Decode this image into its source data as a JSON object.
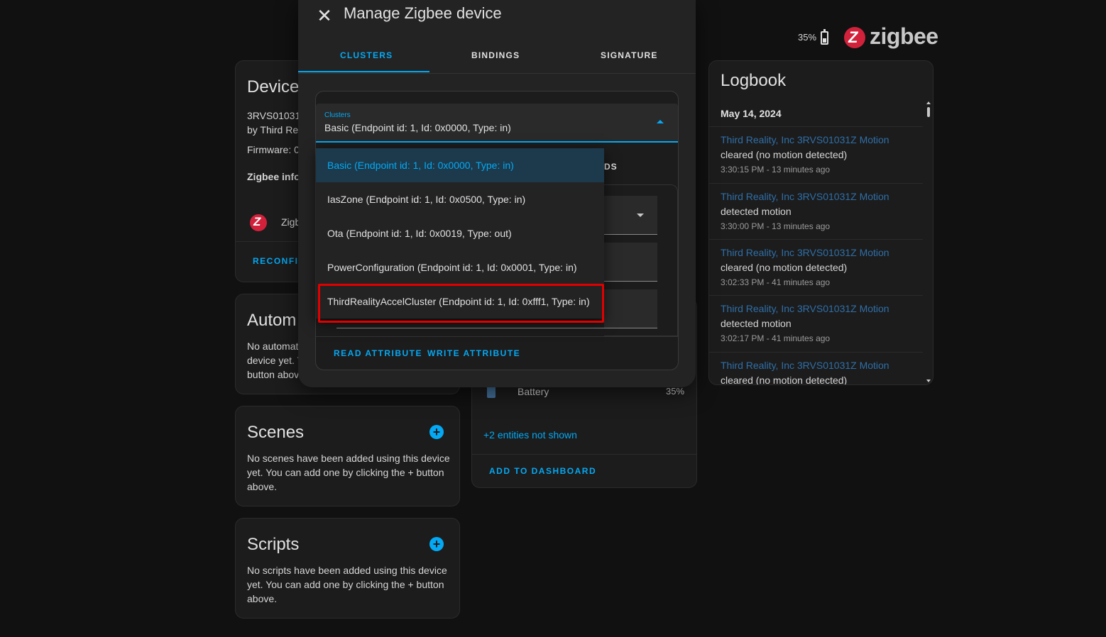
{
  "header": {
    "battery_percent": "35%",
    "brand_word": "zigbee",
    "brand_color": "#d1213b"
  },
  "device_card": {
    "title": "Device",
    "model": "3RVS01031",
    "manufacturer": "by Third Rea",
    "firmware": "Firmware: 0",
    "zigbee_info": "Zigbee info",
    "zigbee_row_label": "Zigb",
    "reconfigure": "RECONFIG"
  },
  "automations_card": {
    "title": "Autom",
    "text_lines": [
      "No automat",
      "device yet. Y",
      "button abov"
    ]
  },
  "scenes_card": {
    "title": "Scenes",
    "plus": "+",
    "text_lines": [
      "No scenes have been added using this device",
      "yet. You can add one by clicking the + button",
      "above."
    ]
  },
  "scripts_card": {
    "title": "Scripts",
    "plus": "+",
    "text_lines": [
      "No scripts have been added using this device",
      "yet. You can add one by clicking the + button",
      "above."
    ]
  },
  "entities_card": {
    "battery_label": "Battery",
    "battery_value": "35%",
    "not_shown": "+2 entities not shown",
    "add_to_dashboard": "ADD TO DASHBOARD"
  },
  "dialog": {
    "close_icon": "close-icon",
    "title": "Manage Zigbee device",
    "tabs": [
      "CLUSTERS",
      "BINDINGS",
      "SIGNATURE"
    ],
    "active_tab": "CLUSTERS",
    "select": {
      "label": "Clusters",
      "value": "Basic (Endpoint id: 1, Id: 0x0000, Type: in)"
    },
    "obscured_tail": "DS",
    "options": [
      "Basic (Endpoint id: 1, Id: 0x0000, Type: in)",
      "IasZone (Endpoint id: 1, Id: 0x0500, Type: in)",
      "Ota (Endpoint id: 1, Id: 0x0019, Type: out)",
      "PowerConfiguration (Endpoint id: 1, Id: 0x0001, Type: in)",
      "ThirdRealityAccelCluster (Endpoint id: 1, Id: 0xfff1, Type: in)"
    ],
    "selected_option": "Basic (Endpoint id: 1, Id: 0x0000, Type: in)",
    "highlighted_option": "ThirdRealityAccelCluster (Endpoint id: 1, Id: 0xfff1, Type: in)",
    "highlight_color": "#e00000",
    "actions": {
      "read": "READ ATTRIBUTE",
      "write": "WRITE ATTRIBUTE"
    },
    "accent_color": "#03a9f4"
  },
  "logbook": {
    "title": "Logbook",
    "date": "May 14, 2024",
    "entries": [
      {
        "source": "Third Reality, Inc 3RVS01031Z Motion",
        "message": "cleared (no motion detected)",
        "time": "3:30:15 PM - 13 minutes ago"
      },
      {
        "source": "Third Reality, Inc 3RVS01031Z Motion",
        "message": "detected motion",
        "time": "3:30:00 PM - 13 minutes ago"
      },
      {
        "source": "Third Reality, Inc 3RVS01031Z Motion",
        "message": "cleared (no motion detected)",
        "time": "3:02:33 PM - 41 minutes ago"
      },
      {
        "source": "Third Reality, Inc 3RVS01031Z Motion",
        "message": "detected motion",
        "time": "3:02:17 PM - 41 minutes ago"
      },
      {
        "source": "Third Reality, Inc 3RVS01031Z Motion",
        "message": "cleared (no motion detected)",
        "time": ""
      }
    ]
  }
}
